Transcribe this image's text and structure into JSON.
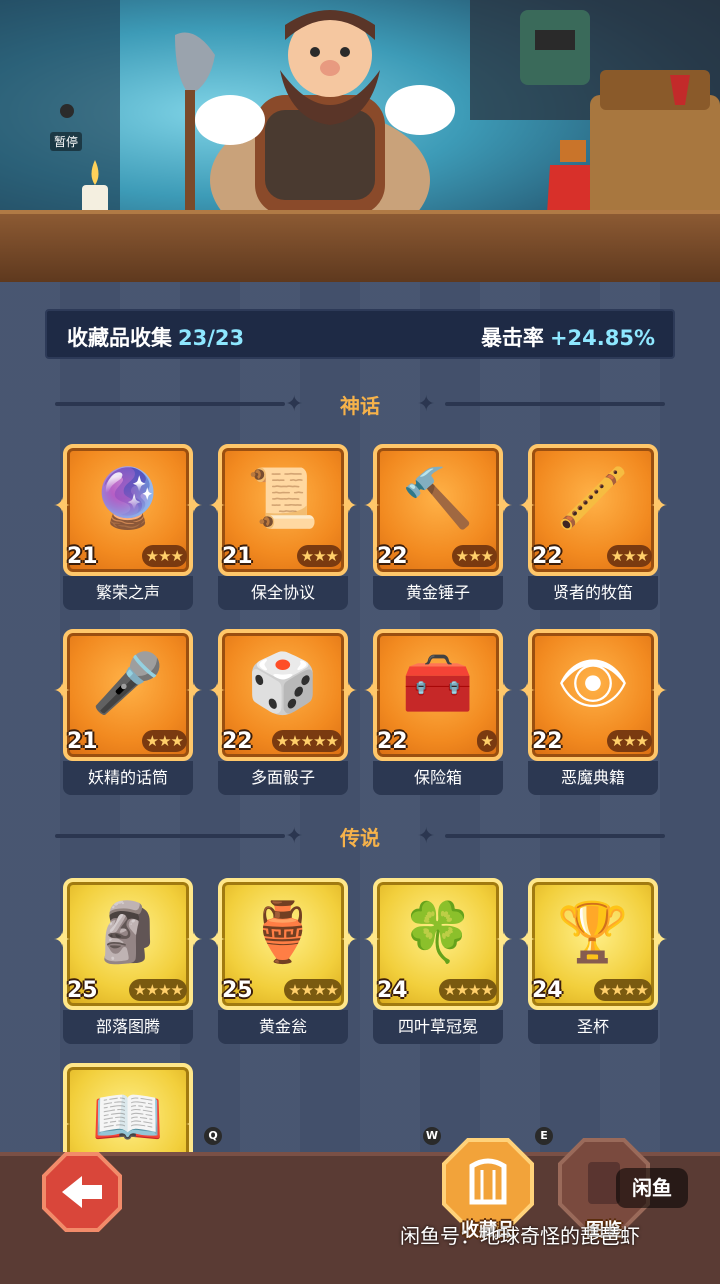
{
  "banner": {
    "pause_label": "暂停"
  },
  "stats": {
    "collection_label": "收藏品收集",
    "collection_value": "23/23",
    "crit_label": "暴击率",
    "crit_value": "+24.85%"
  },
  "sections": [
    {
      "title": "神话",
      "rarity": "mythic",
      "items": [
        {
          "name": "繁荣之声",
          "level": "21",
          "stars": 3,
          "max_stars": 3,
          "icon": "blue-orb-icon"
        },
        {
          "name": "保全协议",
          "level": "21",
          "stars": 3,
          "max_stars": 3,
          "icon": "contract-scroll-icon"
        },
        {
          "name": "黄金锤子",
          "level": "22",
          "stars": 3,
          "max_stars": 3,
          "icon": "golden-hammer-icon"
        },
        {
          "name": "贤者的牧笛",
          "level": "22",
          "stars": 3,
          "max_stars": 3,
          "icon": "sage-flute-icon"
        },
        {
          "name": "妖精的话筒",
          "level": "21",
          "stars": 3,
          "max_stars": 3,
          "icon": "fairy-microphone-icon"
        },
        {
          "name": "多面骰子",
          "level": "22",
          "stars": 5,
          "max_stars": 5,
          "icon": "polyhedral-dice-icon"
        },
        {
          "name": "保险箱",
          "level": "22",
          "stars": 1,
          "max_stars": 1,
          "icon": "treasure-chest-icon"
        },
        {
          "name": "恶魔典籍",
          "level": "22",
          "stars": 3,
          "max_stars": 3,
          "icon": "demon-tome-icon"
        }
      ]
    },
    {
      "title": "传说",
      "rarity": "legend",
      "items": [
        {
          "name": "部落图腾",
          "level": "25",
          "stars": 4,
          "max_stars": 4,
          "icon": "tribal-totem-icon"
        },
        {
          "name": "黄金瓮",
          "level": "25",
          "stars": 4,
          "max_stars": 4,
          "icon": "golden-urn-icon"
        },
        {
          "name": "四叶草冠冕",
          "level": "24",
          "stars": 4,
          "max_stars": 4,
          "icon": "clover-crown-icon"
        },
        {
          "name": "圣杯",
          "level": "24",
          "stars": 4,
          "max_stars": 4,
          "icon": "holy-grail-icon"
        },
        {
          "name": "",
          "level": "",
          "stars": 0,
          "max_stars": 0,
          "icon": "open-book-icon"
        }
      ]
    }
  ],
  "bottom_nav": {
    "key_q": "Q",
    "key_w": "W",
    "key_e": "E",
    "collectibles_label": "收藏品",
    "catalog_label": "图鉴"
  },
  "watermark": {
    "badge": "闲鱼",
    "text": "闲鱼号：地球奇怪的琵琶虾"
  }
}
